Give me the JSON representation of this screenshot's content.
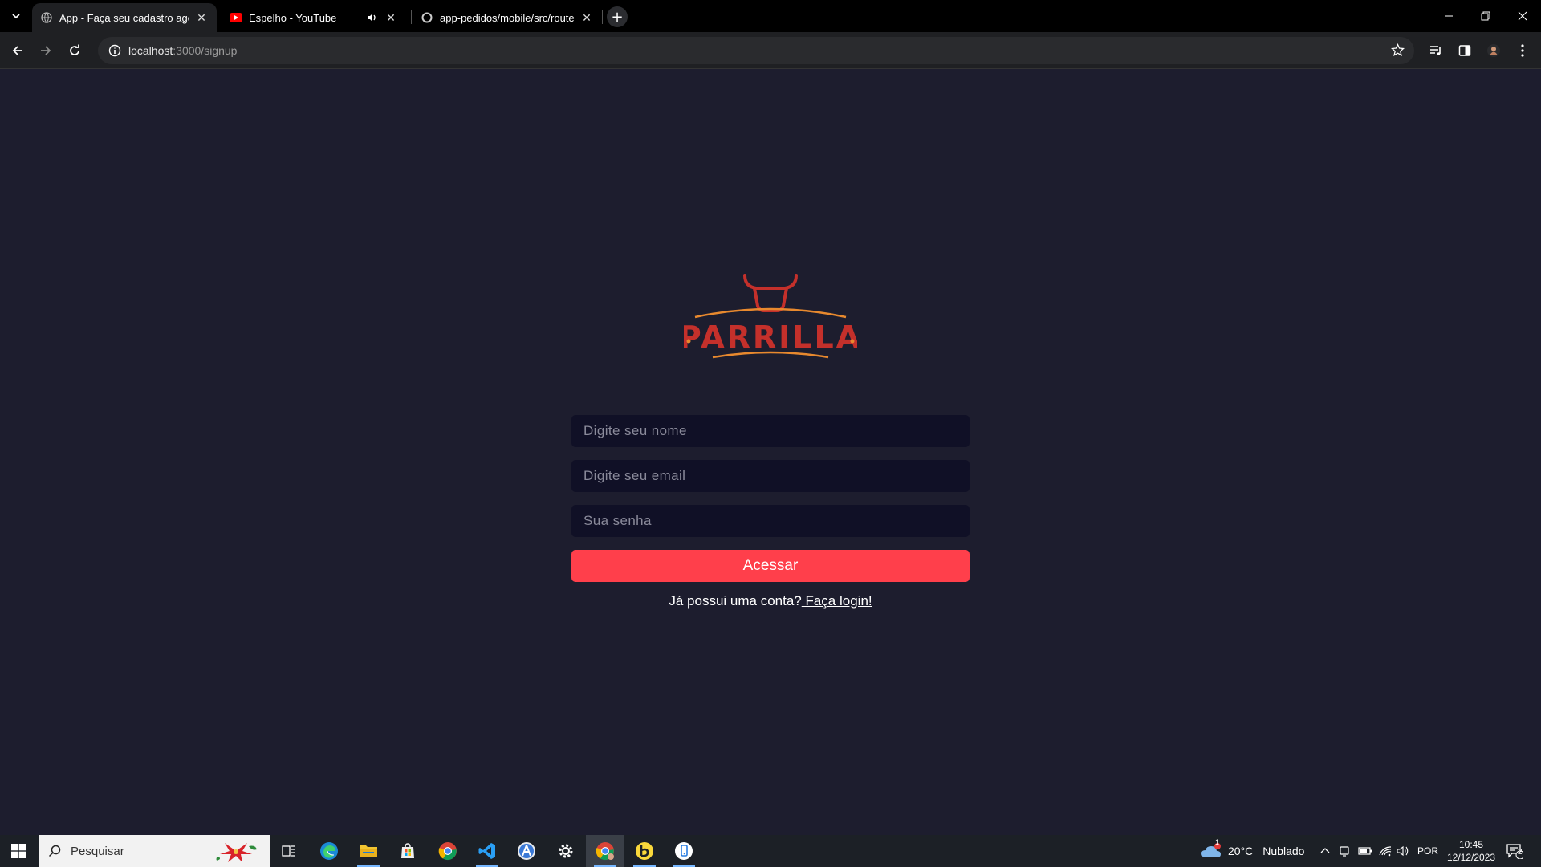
{
  "browser": {
    "tabs": [
      {
        "title": "App - Faça seu cadastro agora!",
        "active": true
      },
      {
        "title": "Espelho - YouTube",
        "active": false
      },
      {
        "title": "app-pedidos/mobile/src/route",
        "active": false
      }
    ],
    "url_host": "localhost",
    "url_path": ":3000/signup"
  },
  "page": {
    "logo_text": "PARRILLA",
    "name_placeholder": "Digite seu nome",
    "email_placeholder": "Digite seu email",
    "password_placeholder": "Sua senha",
    "submit_label": "Acessar",
    "have_account_text": "Já possui uma conta?",
    "login_link": " Faça login!"
  },
  "taskbar": {
    "search_placeholder": "Pesquisar",
    "weather_temp": "20°C",
    "weather_desc": "Nublado",
    "weather_badge": "1",
    "language": "POR",
    "time": "10:45",
    "date": "12/12/2023",
    "notification_count": "2"
  },
  "colors": {
    "page_bg": "#1d1d2e",
    "input_bg": "#101026",
    "accent": "#ff3f4b",
    "logo": "#c4302b"
  }
}
